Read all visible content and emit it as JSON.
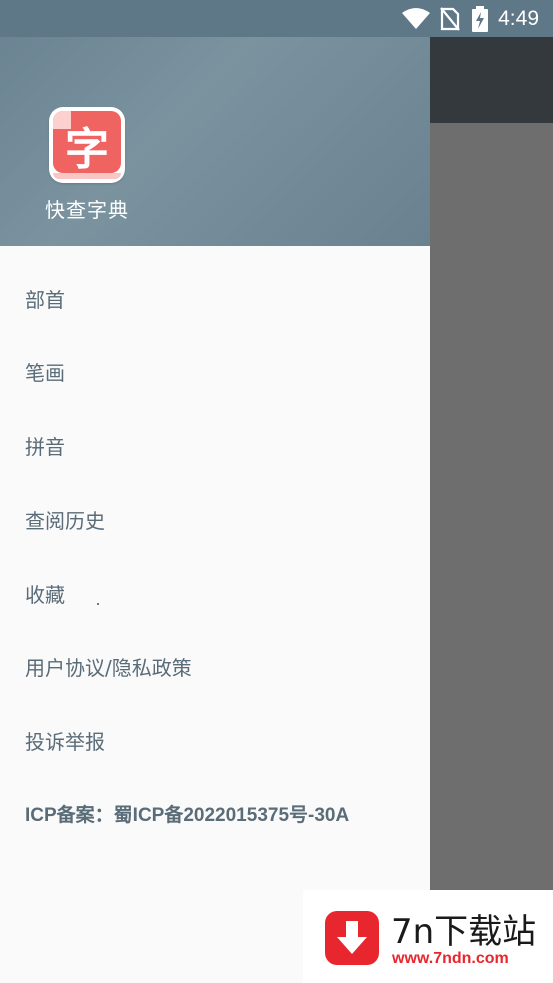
{
  "status_bar": {
    "time": "4:49",
    "icons": [
      "wifi-icon",
      "no-sim-icon",
      "battery-charging-icon"
    ]
  },
  "drawer": {
    "app_logo_char": "字",
    "app_name": "快查字典",
    "menu": [
      {
        "label": "部首"
      },
      {
        "label": "笔画"
      },
      {
        "label": "拼音"
      },
      {
        "label": "查阅历史"
      },
      {
        "label": "收藏"
      },
      {
        "label": "用户协议/隐私政策"
      },
      {
        "label": "投诉举报"
      },
      {
        "label": "ICP备案：蜀ICP备2022015375号-30A"
      }
    ]
  },
  "watermark": {
    "title": "7n下载站",
    "url": "www.7ndn.com",
    "icon": "download-arrow-icon"
  },
  "colors": {
    "status_bar": "#5f7888",
    "drawer_header": "#71899a",
    "menu_text": "#5a6c78",
    "scrim": "#6e6e6e",
    "watermark_red": "#e8262d"
  }
}
